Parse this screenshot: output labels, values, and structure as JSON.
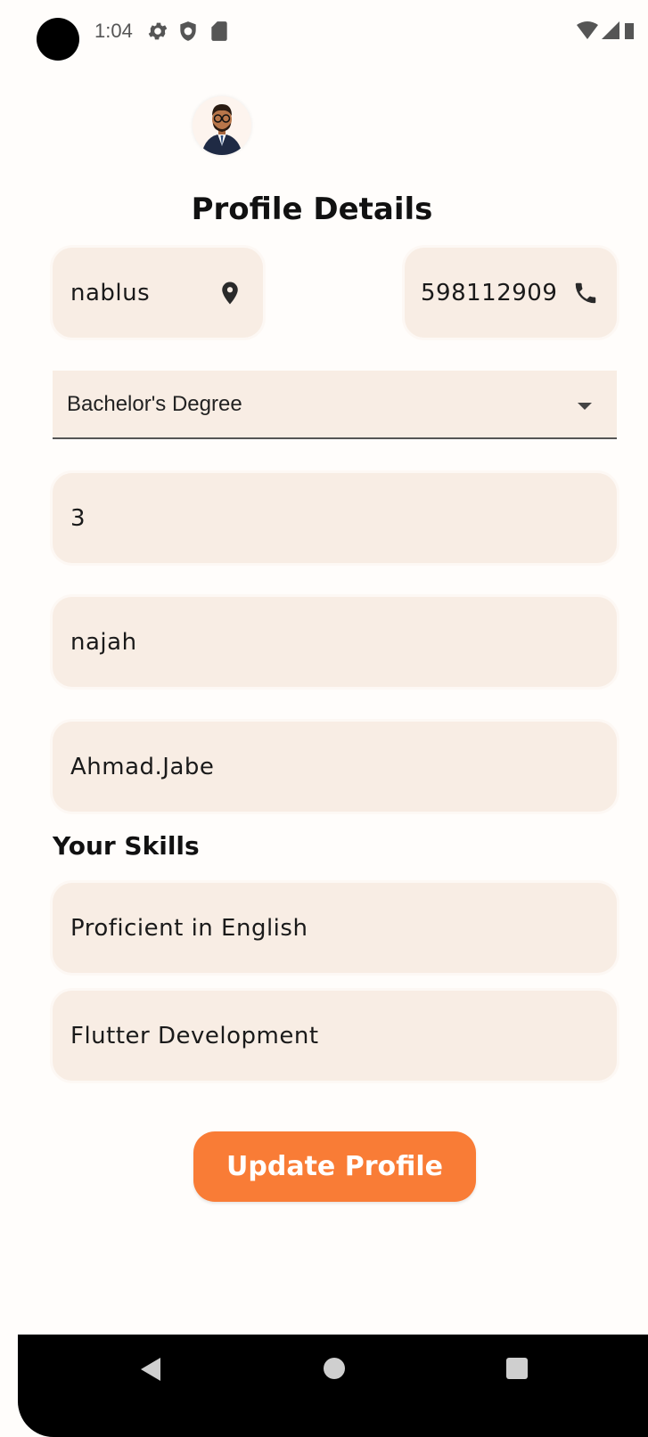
{
  "status_bar": {
    "time": "1:04",
    "left_icons": [
      "settings-icon",
      "shield-icon",
      "sd-card-icon"
    ],
    "right_icons": [
      "wifi-icon",
      "signal-icon",
      "battery-icon"
    ]
  },
  "profile": {
    "title": "Profile Details",
    "location": "nablus",
    "phone": "598112909",
    "degree_selected": "Bachelor's Degree",
    "field_3": "3",
    "field_university": "najah",
    "field_username": "Ahmad.Jabe"
  },
  "skills": {
    "label": "Your Skills",
    "items": [
      "Proficient in English",
      "Flutter Development"
    ]
  },
  "actions": {
    "update_label": "Update Profile"
  },
  "colors": {
    "field_bg": "#f8ede4",
    "accent": "#f97c36"
  }
}
